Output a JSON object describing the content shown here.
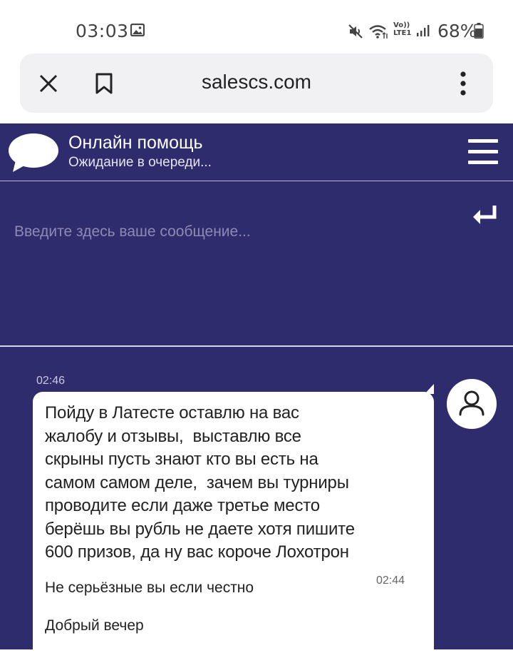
{
  "status_bar": {
    "time": "03:03",
    "volte_line1": "Vo))",
    "volte_line2": "LTE1",
    "battery": "68%"
  },
  "browser": {
    "url": "salescs.com"
  },
  "chat": {
    "header": {
      "title": "Онлайн помощь",
      "subtitle": "Ожидание в очереди..."
    },
    "input": {
      "placeholder": "Введите здесь ваше сообщение..."
    },
    "messages": [
      {
        "time": "02:46",
        "lines": [
          "Пойду в Латесте оставлю на вас",
          "жалобу и отзывы,  выставлю все",
          "скрыны пусть знают кто вы есть на",
          "самом самом деле,  зачем вы турниры",
          "проводите если даже третье место",
          "берёшь вы рубль не даете хотя пишите",
          "600 призов, да ну вас короче Лохотрон"
        ],
        "second_time": "02:44",
        "second_text": "Не серьёзные вы если честно",
        "third_text": "Добрый вечер"
      }
    ]
  },
  "colors": {
    "chat_bg": "#2f2c6e",
    "bubble_bg": "#ffffff",
    "url_bar_bg": "#f1f1f4"
  },
  "icons": {
    "gallery": "gallery-icon",
    "mute": "mute-icon",
    "wifi": "wifi-icon",
    "signal": "signal-icon",
    "battery": "battery-icon",
    "close": "close-icon",
    "bookmark": "bookmark-icon",
    "menu": "more-vert-icon",
    "chat_logo": "chat-bubble-icon",
    "hamburger": "hamburger-icon",
    "send": "enter-icon",
    "avatar": "user-icon"
  }
}
